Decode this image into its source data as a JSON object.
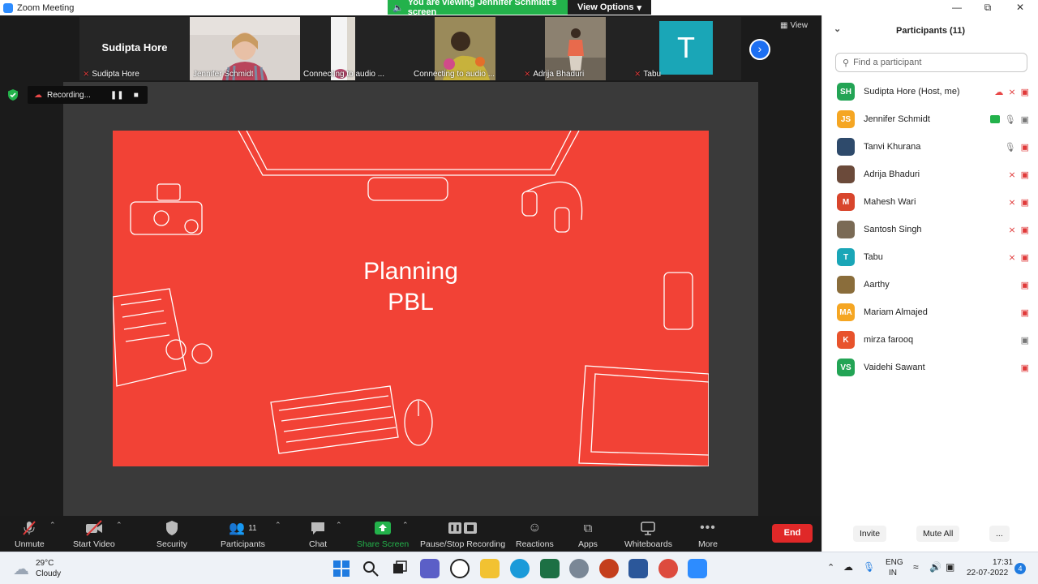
{
  "window": {
    "title": "Zoom Meeting"
  },
  "banner": {
    "message": "You are viewing Jennifer Schmidt's screen",
    "view_options": "View Options"
  },
  "view_button": "View",
  "thumbnails": [
    {
      "name": "Sudipta Hore",
      "display": "Sudipta Hore",
      "muted": true
    },
    {
      "name": "Jennifer Schmidt",
      "display": "",
      "muted": false
    },
    {
      "name": "Connecting to audio ...",
      "display": "",
      "muted": false
    },
    {
      "name": "Connecting to audio ...",
      "display": "",
      "muted": false
    },
    {
      "name": "Adrija Bhaduri",
      "display": "",
      "muted": true
    },
    {
      "name": "Tabu",
      "display": "T",
      "muted": true
    }
  ],
  "recording": {
    "label": "Recording..."
  },
  "slide": {
    "line1": "Planning",
    "line2": "PBL"
  },
  "toolbar": {
    "unmute": "Unmute",
    "start_video": "Start Video",
    "security": "Security",
    "participants": "Participants",
    "participants_count": "11",
    "chat": "Chat",
    "share_screen": "Share Screen",
    "pause_stop_recording": "Pause/Stop Recording",
    "reactions": "Reactions",
    "apps": "Apps",
    "whiteboards": "Whiteboards",
    "more": "More",
    "end": "End"
  },
  "panel": {
    "title": "Participants (11)",
    "search_placeholder": "Find a participant",
    "participants": [
      {
        "initials": "SH",
        "name": "Sudipta Hore (Host, me)",
        "color": "#23a455"
      },
      {
        "initials": "JS",
        "name": "Jennifer Schmidt",
        "color": "#f5a623"
      },
      {
        "initials": "",
        "name": "Tanvi Khurana",
        "color": "#2e4a6b"
      },
      {
        "initials": "",
        "name": "Adrija Bhaduri",
        "color": "#6b4a3a"
      },
      {
        "initials": "M",
        "name": "Mahesh Wari",
        "color": "#d8452c"
      },
      {
        "initials": "",
        "name": "Santosh Singh",
        "color": "#7a6a55"
      },
      {
        "initials": "T",
        "name": "Tabu",
        "color": "#1aa6b7"
      },
      {
        "initials": "",
        "name": "Aarthy",
        "color": "#8a6d3b"
      },
      {
        "initials": "MA",
        "name": "Mariam Almajed",
        "color": "#f5a623"
      },
      {
        "initials": "K",
        "name": "mirza farooq",
        "color": "#e8532c"
      },
      {
        "initials": "VS",
        "name": "Vaidehi Sawant",
        "color": "#23a455"
      }
    ],
    "invite": "Invite",
    "mute_all": "Mute All",
    "more": "..."
  },
  "taskbar": {
    "weather_temp": "29°C",
    "weather_desc": "Cloudy",
    "lang1": "ENG",
    "lang2": "IN",
    "time": "17:31",
    "date": "22-07-2022",
    "notifications": "4"
  }
}
